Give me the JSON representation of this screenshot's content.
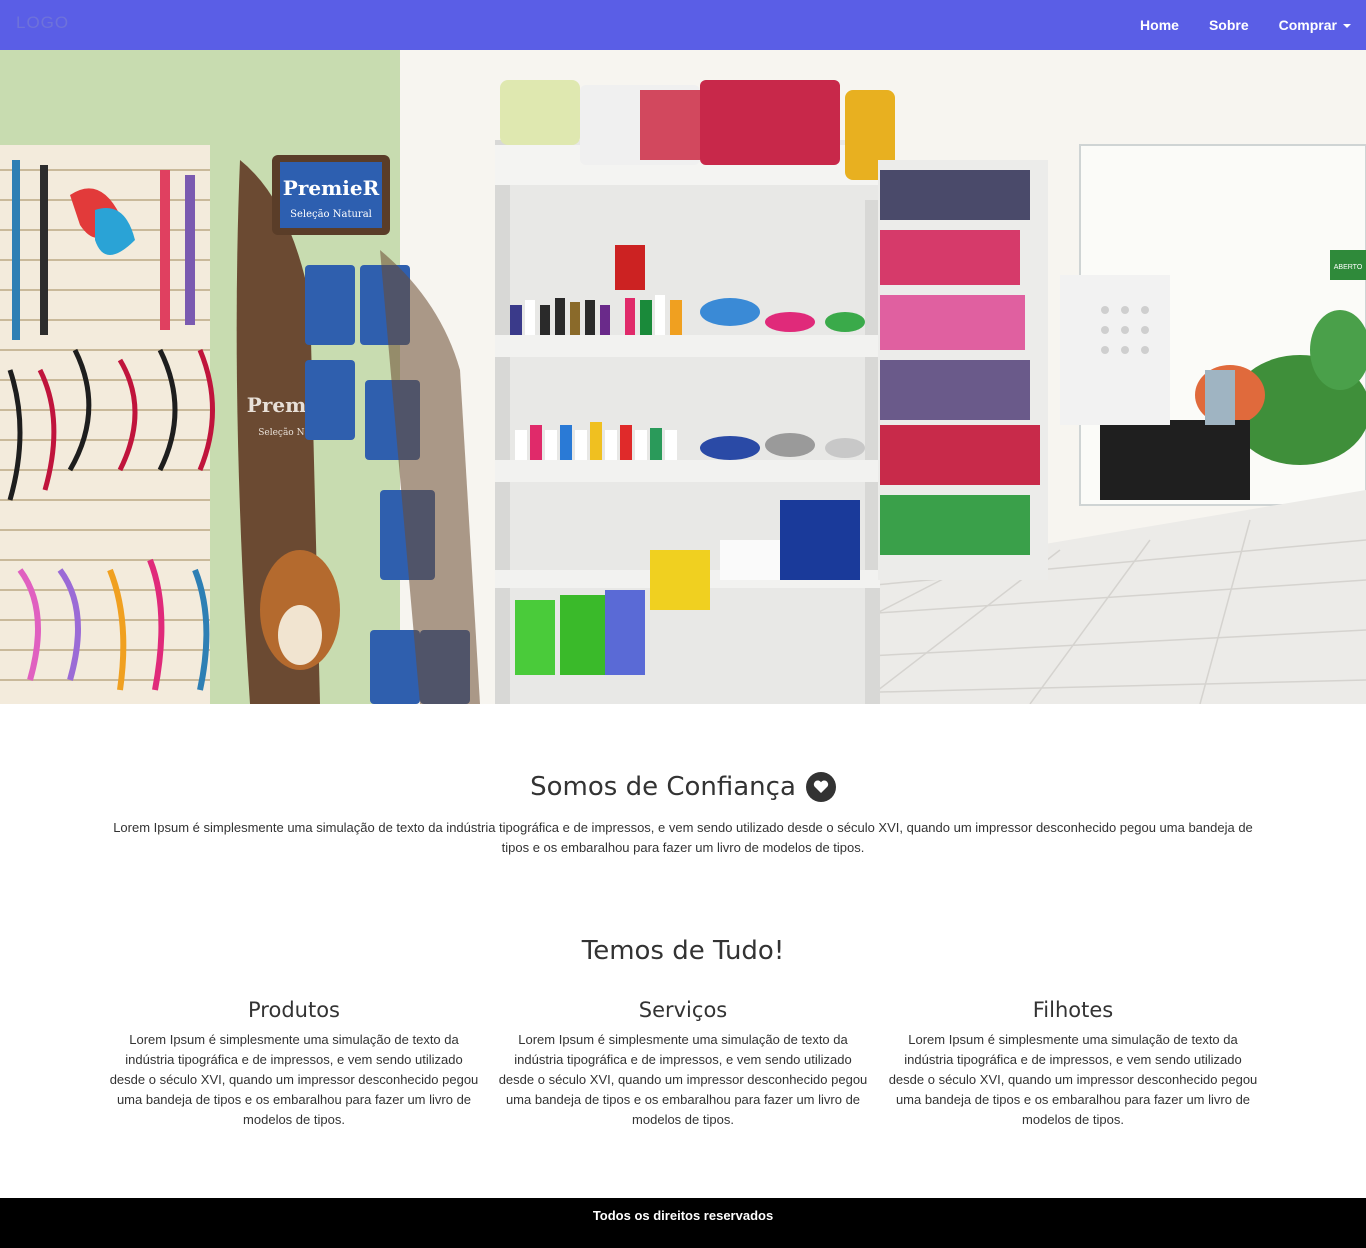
{
  "nav": {
    "logo": "LOGO",
    "links": [
      {
        "label": "Home"
      },
      {
        "label": "Sobre"
      },
      {
        "label": "Comprar"
      }
    ]
  },
  "hero": {
    "sign_premier_1": "PremieR",
    "sign_premier_1_sub": "Seleção Natural",
    "sign_premier_2": "PremieR",
    "sign_premier_2_sub": "Seleção Natural",
    "sign_aberto": "ABERTO"
  },
  "confianca": {
    "title": "Somos de Confiança",
    "icon": "heart-icon",
    "text": "Lorem Ipsum é simplesmente uma simulação de texto da indústria tipográfica e de impressos, e vem sendo utilizado desde o século XVI, quando um impressor desconhecido pegou uma bandeja de tipos e os embaralhou para fazer um livro de modelos de tipos."
  },
  "tudo": {
    "title": "Temos de Tudo!",
    "columns": [
      {
        "title": "Produtos",
        "text": "Lorem Ipsum é simplesmente uma simulação de texto da indústria tipográfica e de impressos, e vem sendo utilizado desde o século XVI, quando um impressor desconhecido pegou uma bandeja de tipos e os embaralhou para fazer um livro de modelos de tipos."
      },
      {
        "title": "Serviços",
        "text": "Lorem Ipsum é simplesmente uma simulação de texto da indústria tipográfica e de impressos, e vem sendo utilizado desde o século XVI, quando um impressor desconhecido pegou uma bandeja de tipos e os embaralhou para fazer um livro de modelos de tipos."
      },
      {
        "title": "Filhotes",
        "text": "Lorem Ipsum é simplesmente uma simulação de texto da indústria tipográfica e de impressos, e vem sendo utilizado desde o século XVI, quando um impressor desconhecido pegou uma bandeja de tipos e os embaralhou para fazer um livro de modelos de tipos."
      }
    ]
  },
  "footer": {
    "text": "Todos os direitos reservados"
  },
  "colors": {
    "navbar": "#5a5ee6",
    "footer": "#000000",
    "text": "#333333"
  }
}
